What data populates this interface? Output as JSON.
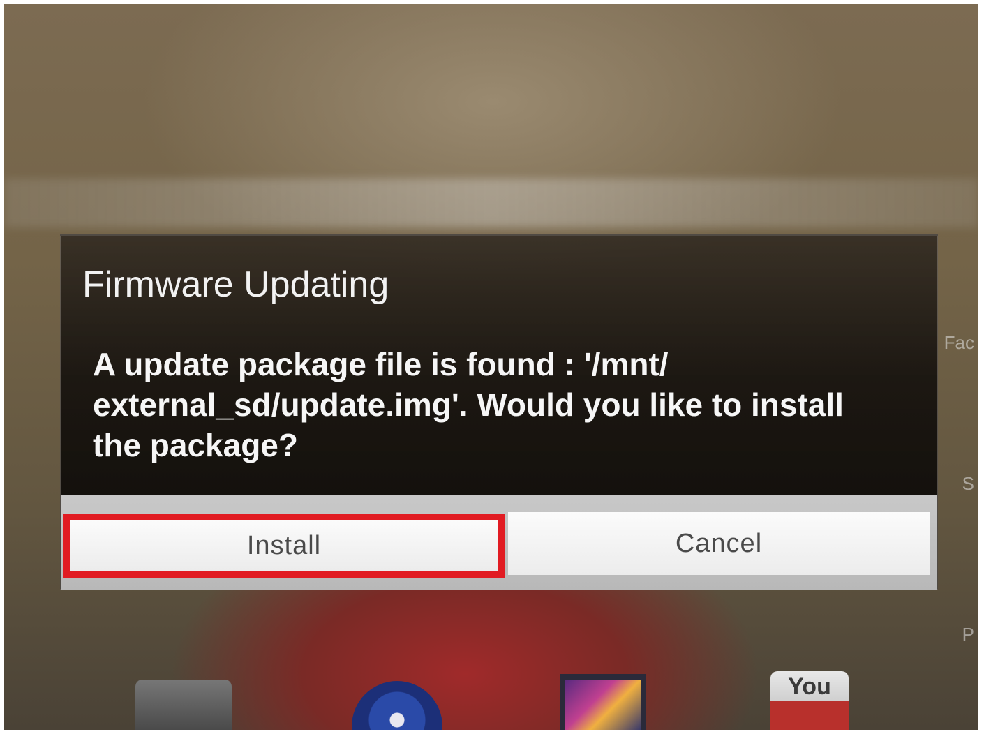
{
  "dialog": {
    "title": "Firmware Updating",
    "message": "A update package file is found : '/mnt/ external_sd/update.img'. Would you like to install the package?",
    "buttons": {
      "install_label": "Install",
      "cancel_label": "Cancel"
    }
  },
  "highlight": {
    "target": "install-button",
    "color": "#e11b22"
  },
  "dock": {
    "icons": [
      "camera-icon",
      "music-icon",
      "gallery-icon",
      "youtube-icon"
    ],
    "youtube_text": "You"
  },
  "side_apps": {
    "labels": [
      "Fac",
      "S",
      "P"
    ]
  },
  "colors": {
    "dialog_background": "#141008",
    "title_text": "#f2f2f2",
    "button_background": "#f5f5f5",
    "button_text": "#4a4a4a"
  }
}
